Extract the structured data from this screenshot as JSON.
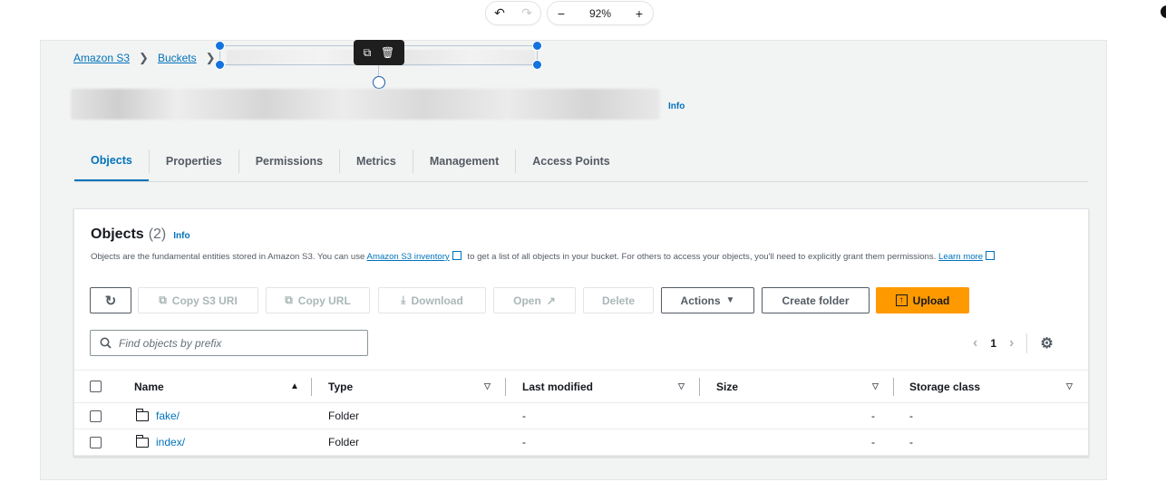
{
  "editor": {
    "zoom": "92%",
    "undo_icon": "↶",
    "redo_icon": "↷",
    "zoom_out": "−",
    "zoom_in": "+"
  },
  "breadcrumb": {
    "items": [
      "Amazon S3",
      "Buckets"
    ]
  },
  "header": {
    "info": "Info"
  },
  "tabs": [
    "Objects",
    "Properties",
    "Permissions",
    "Metrics",
    "Management",
    "Access Points"
  ],
  "objects_panel": {
    "title": "Objects",
    "count": "(2)",
    "info": "Info",
    "desc_1": "Objects are the fundamental entities stored in Amazon S3. You can use",
    "desc_link": "Amazon S3 inventory",
    "desc_2": "to get a list of all objects in your bucket. For others to access your objects, you'll need to explicitly grant them permissions.",
    "learn_more": "Learn more"
  },
  "actions": {
    "copy_s3_uri": "Copy S3 URI",
    "copy_url": "Copy URL",
    "download": "Download",
    "open": "Open",
    "delete": "Delete",
    "actions": "Actions",
    "create_folder": "Create folder",
    "upload": "Upload"
  },
  "search": {
    "placeholder": "Find objects by prefix"
  },
  "pagination": {
    "page": "1"
  },
  "table": {
    "columns": [
      "Name",
      "Type",
      "Last modified",
      "Size",
      "Storage class"
    ],
    "rows": [
      {
        "name": "fake/",
        "type": "Folder",
        "last_modified": "-",
        "size": "-",
        "storage_class": "-"
      },
      {
        "name": "index/",
        "type": "Folder",
        "last_modified": "-",
        "size": "-",
        "storage_class": "-"
      }
    ]
  },
  "colors": {
    "link": "#0073bb",
    "primary": "#ff9900",
    "selection": "#1273de"
  }
}
